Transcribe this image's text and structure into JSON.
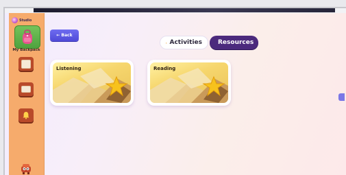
{
  "sidebar": {
    "logo_text": "Studio",
    "backpack_label": "My Backpack",
    "buttons": [
      {
        "icon": "book-icon"
      },
      {
        "icon": "monitor-icon"
      },
      {
        "icon": "bell-icon"
      }
    ],
    "character_icon": "robot-character-icon"
  },
  "toolbar": {
    "back_label": "Back"
  },
  "tabs": [
    {
      "label": "Activities",
      "icon": "cone-icon",
      "selected": false
    },
    {
      "label": "Resources",
      "icon": "toolbox-icon",
      "selected": true
    }
  ],
  "cards": [
    {
      "title": "Listening"
    },
    {
      "title": "Reading"
    }
  ],
  "colors": {
    "sidebar": "#f6ab6c",
    "accent_purple": "#4b2a7d",
    "back_button": "#5b57e2",
    "card_gold": "#f6d66d"
  }
}
